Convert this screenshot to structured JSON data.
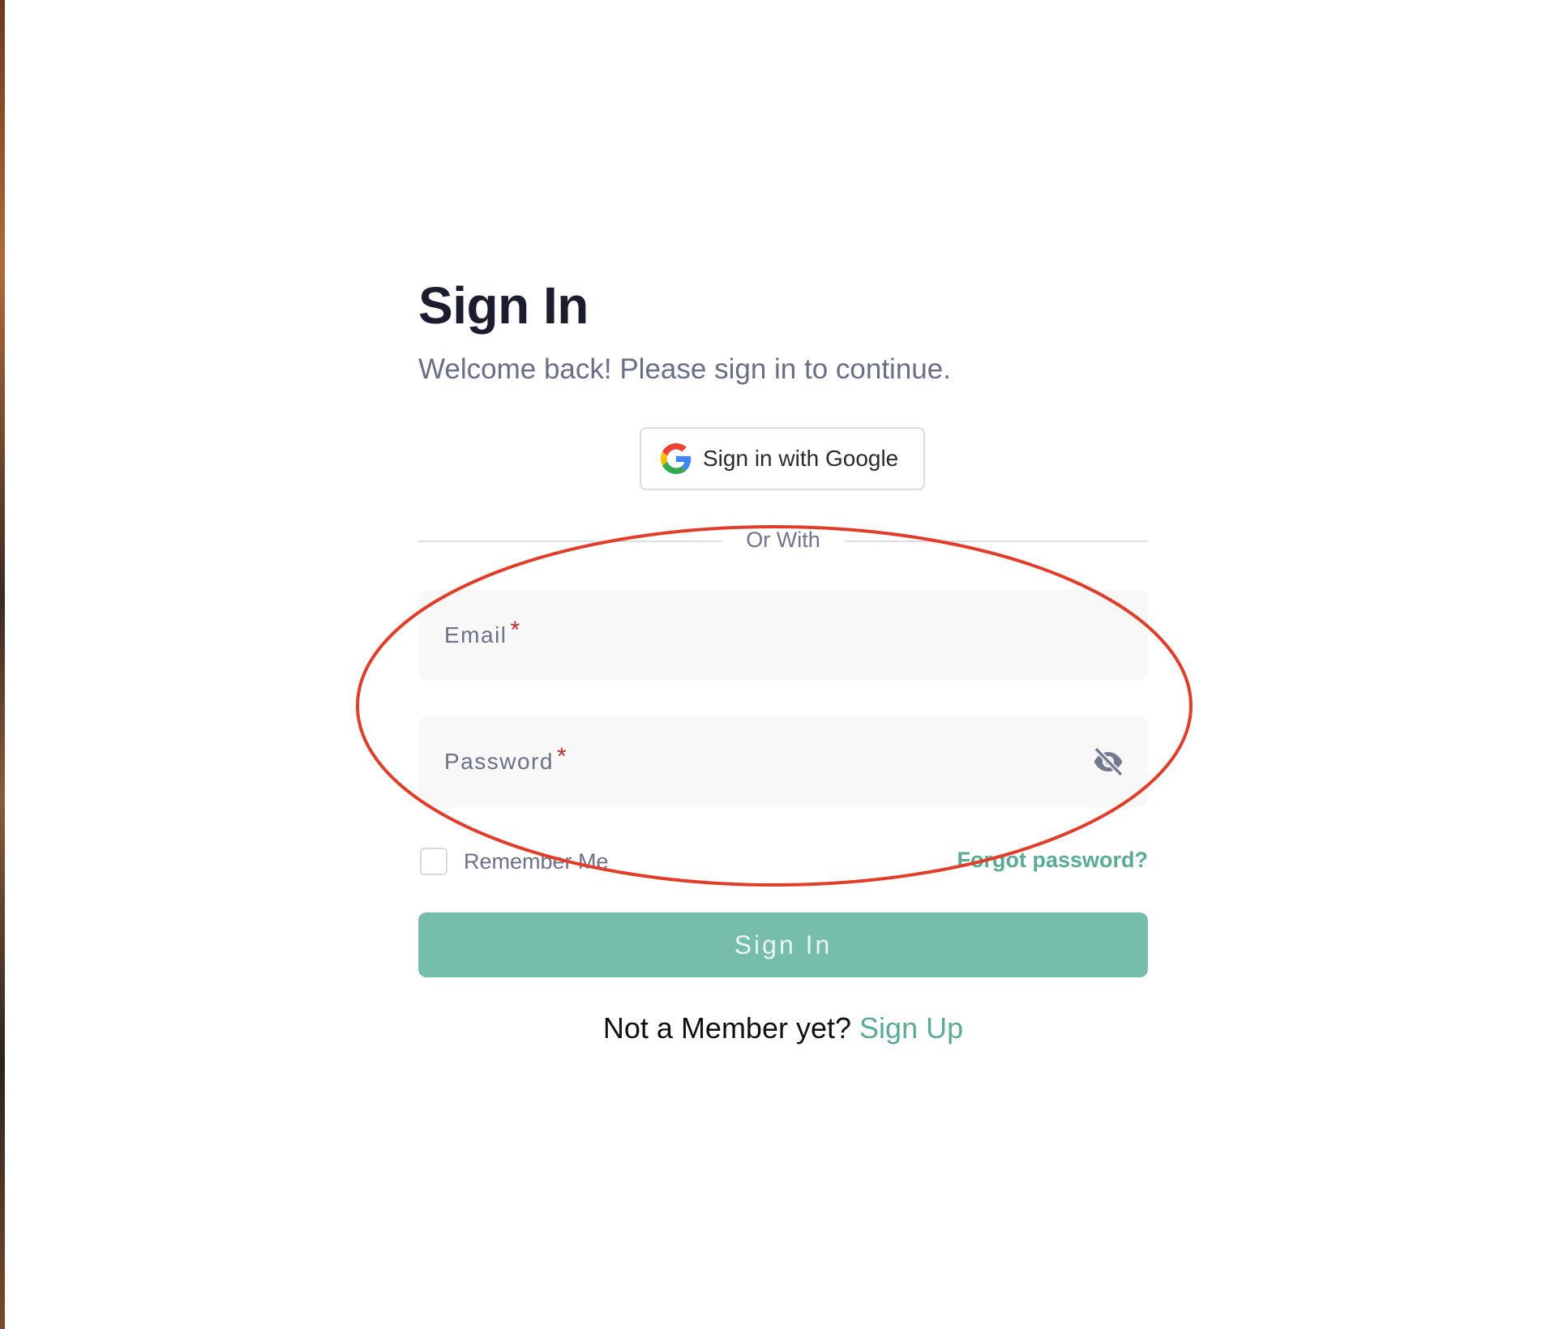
{
  "form": {
    "title": "Sign In",
    "subtitle": "Welcome back! Please sign in to continue.",
    "google_button_label": "Sign in with Google",
    "divider_text": "Or With",
    "email_label": "Email",
    "password_label": "Password",
    "required_marker": "*",
    "remember_label": "Remember Me",
    "forgot_label": "Forgot password?",
    "submit_label": "Sign In",
    "footer_question": "Not a Member yet?",
    "signup_label": "Sign Up"
  },
  "icons": {
    "google": "google-g-icon",
    "password_toggle": "eye-slash-icon"
  },
  "colors": {
    "accent": "#5cab93",
    "button": "#76bdac",
    "title": "#1b1c2e",
    "muted_text": "#6e7087",
    "required": "#b1302b",
    "field_bg": "#f8f8f8",
    "annotation_ellipse": "#e03d2a"
  },
  "remember_checked": false
}
